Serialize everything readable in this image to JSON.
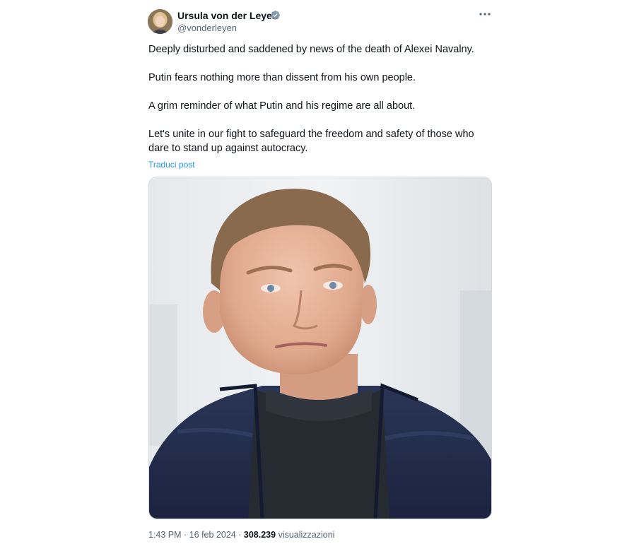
{
  "author": {
    "name": "Ursula von der Leyen",
    "handle": "@vonderleyen",
    "verified_icon": "verified-badge-icon",
    "verified_color": "#829aab"
  },
  "post": {
    "paragraphs": [
      "Deeply disturbed and saddened by news of the death of Alexei Navalny.",
      "Putin fears nothing more than dissent from his own people.",
      "A grim reminder of what Putin and his regime are all about.",
      "Let's unite in our fight to safeguard the freedom and safety of those who",
      "dare to stand up against autocracy."
    ],
    "translate_label": "Traduci post",
    "translate_color": "#1d9bf0",
    "media_icon": "portrait-photo"
  },
  "meta": {
    "time": "1:43 PM",
    "separator": "·",
    "date": "16 feb 2024",
    "views_count": "308.239",
    "views_label": "visualizzazioni"
  },
  "menu": {
    "icon": "more-horizontal-icon"
  }
}
